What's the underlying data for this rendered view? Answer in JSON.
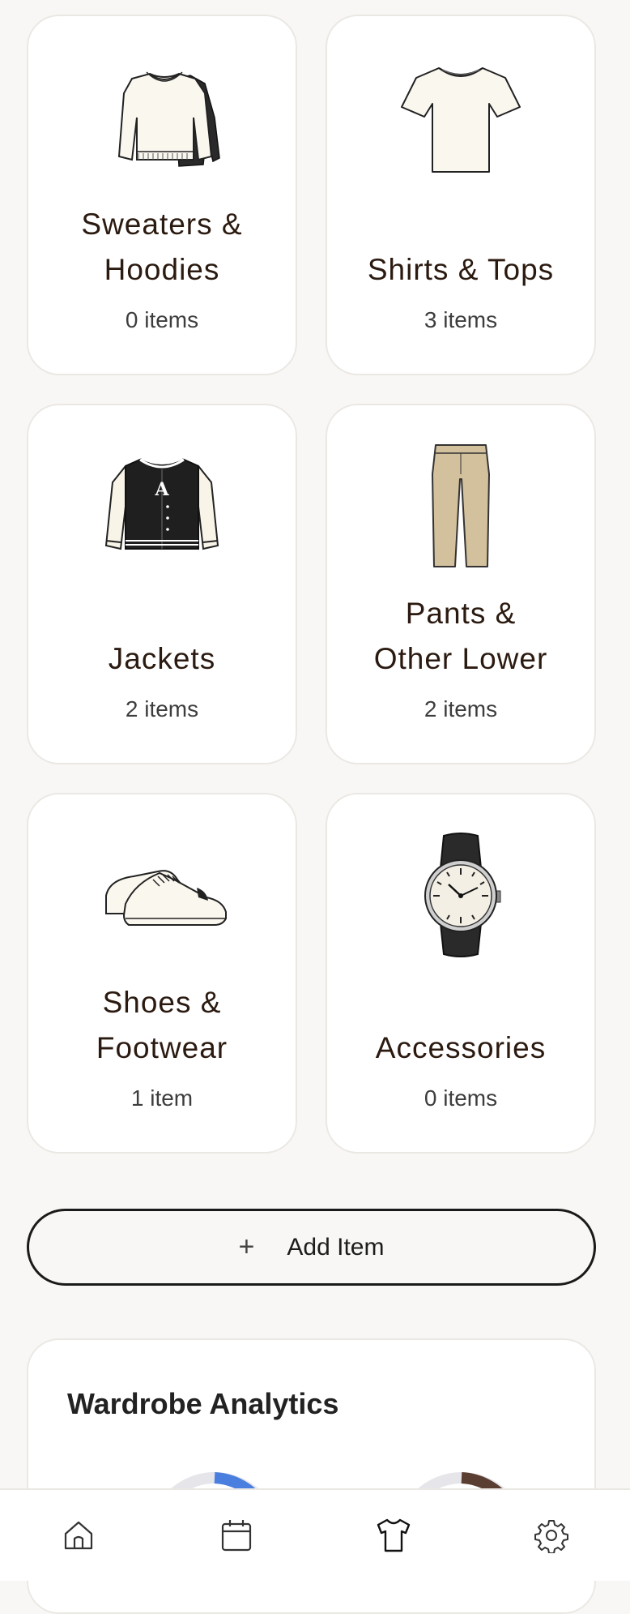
{
  "categories": [
    {
      "name": "Sweaters &\nHoodies",
      "count": "0 items",
      "icon": "sweater-hoodie-icon"
    },
    {
      "name": "Shirts & Tops",
      "count": "3 items",
      "icon": "tshirt-icon"
    },
    {
      "name": "Jackets",
      "count": "2 items",
      "icon": "varsity-jacket-icon"
    },
    {
      "name": "Pants &\nOther Lower",
      "count": "2 items",
      "icon": "pants-icon"
    },
    {
      "name": "Shoes &\nFootwear",
      "count": "1 item",
      "icon": "sneakers-icon"
    },
    {
      "name": "Accessories",
      "count": "0 items",
      "icon": "wristwatch-icon"
    }
  ],
  "add_button": {
    "icon": "plus-icon",
    "label": "Add Item"
  },
  "analytics": {
    "title": "Wardrobe Analytics",
    "gauges": [
      {
        "color": "#4a7fe0",
        "icon": "gauge-chart"
      },
      {
        "color": "#5b3e32",
        "icon": "gauge-chart"
      }
    ]
  },
  "nav": [
    {
      "icon": "home-icon",
      "active": false
    },
    {
      "icon": "calendar-icon",
      "active": false
    },
    {
      "icon": "wardrobe-shirt-icon",
      "active": true
    },
    {
      "icon": "settings-gear-icon",
      "active": false
    }
  ]
}
